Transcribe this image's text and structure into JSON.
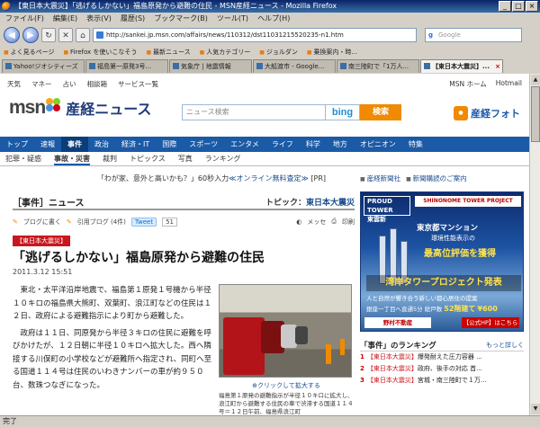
{
  "window": {
    "title": "【東日本大震災】「逃げるしかない」福島原発から避難の住民 - MSN産経ニュース - Mozilla Firefox",
    "buttons": [
      "_",
      "□",
      "×"
    ]
  },
  "menu": [
    "ファイル(F)",
    "編集(E)",
    "表示(V)",
    "履歴(S)",
    "ブックマーク(B)",
    "ツール(T)",
    "ヘルプ(H)"
  ],
  "address": {
    "url": "http://sankei.jp.msn.com/affairs/news/110312/dst11031215520235-n1.htm",
    "search_placeholder": "Google"
  },
  "bookmarks": [
    "よく見るページ",
    "Firefox を使いこなそう",
    "最新ニュース",
    "人気カテゴリー",
    "ジョルダン",
    "乗換案内・時..."
  ],
  "tabs": [
    {
      "label": "Yahoo!ジオシティーズ",
      "active": false
    },
    {
      "label": "福島第一原発3号...",
      "active": false
    },
    {
      "label": "気象庁 | 地震情報",
      "active": false
    },
    {
      "label": "大船渡市 - Google...",
      "active": false
    },
    {
      "label": "南三陸町で「1万人...",
      "active": false
    },
    {
      "label": "【東日本大震災】...",
      "active": true
    }
  ],
  "status": "完了",
  "page": {
    "service_links": [
      "天気",
      "マネー",
      "占い",
      "相談箱",
      "サービス一覧"
    ],
    "service_right": [
      "MSN ホーム",
      "Hotmail"
    ],
    "logo": {
      "msn": "msn",
      "sankei": "産経ニュース"
    },
    "search": {
      "placeholder": "ニュース検索",
      "bing": "bing",
      "button": "検索"
    },
    "photo_link": "産経フォト",
    "main_nav": [
      "トップ",
      "速報",
      "事件",
      "政治",
      "経済・IT",
      "国際",
      "スポーツ",
      "エンタメ",
      "ライフ",
      "科学",
      "地方",
      "オピニオン",
      "特集"
    ],
    "sub_nav": [
      "犯罪・疑惑",
      "事故・災害",
      "裁判",
      "トピックス",
      "写真",
      "ランキング"
    ],
    "ad_text": "「わが家、意外と高いかも？」60秒入力",
    "ad_link": "≪オンライン無料査定≫",
    "ad_pr": "[PR]",
    "section_label": "［事件］ニュース",
    "topic_label": "トピック：",
    "topic_link": "東日本大震災",
    "social": {
      "blog": "ブログに書く",
      "quote": "引用ブログ (4件)",
      "tweet": "Tweet",
      "tweet_count": "51",
      "memo": "メッセ",
      "print": "印刷"
    },
    "article": {
      "tag": "【東日本大震災】",
      "headline": "「逃げるしかない」福島原発から避難の住民",
      "date": "2011.3.12 15:51",
      "paragraphs": [
        "東北・太平洋沿岸地震で、福島第１原発１号機から半径１０キロの福島県大熊町、双葉町、浪江町などの住民は１２日、政府による避難指示により町から避難した。",
        "政府は１１日、同原発から半径３キロの住民に避難を呼びかけたが、１２日朝に半径１０キロへ拡大した。西へ隣接する川俣町の小学校などが避難所へ指定され、同町へ至る国道１１４号は住民のいわきナンバーの車が約９５０台、数珠つなぎになった。"
      ],
      "photo_zoom": "クリックして拡大する",
      "photo_caption": "福島第１原発の避難指示が半径１０キロに拡大し、浪江町から避難する住民の車で渋滞する国道１１４号＝１２日午前、福島県浪江町"
    },
    "side_links": [
      "産経新聞社",
      "新聞購読のご案内"
    ],
    "banner": {
      "proud": "PROUD TOWER",
      "sub": "東雲新",
      "project": "SHINONOME TOWER PROJECT",
      "line1": "東京都マンション",
      "line2": "環境性能表示の",
      "line3": "最高位評価を獲得",
      "line4": "湾岸タワープロジェクト発表",
      "line5": "人と自然が響き合う新しい都心居住の提案",
      "line6a": "銀座一丁目へ直通5分",
      "line6b": "総戸数",
      "line6c": "52階建て",
      "line6d": "¥600",
      "company": "野村不動産",
      "detail": "【公式HP】はこちら"
    },
    "ranking": {
      "title": "「事件」のランキング",
      "more": "もっと詳しく",
      "items": [
        {
          "n": "1",
          "tag": "【東日本大震災】",
          "text": "爆発耐えた圧力容器 ..."
        },
        {
          "n": "2",
          "tag": "【東日本大震災】",
          "text": "政府、後手の対応 首..."
        },
        {
          "n": "3",
          "tag": "【東日本大震災】",
          "text": "宮城・南三陸町で１万..."
        }
      ]
    }
  }
}
